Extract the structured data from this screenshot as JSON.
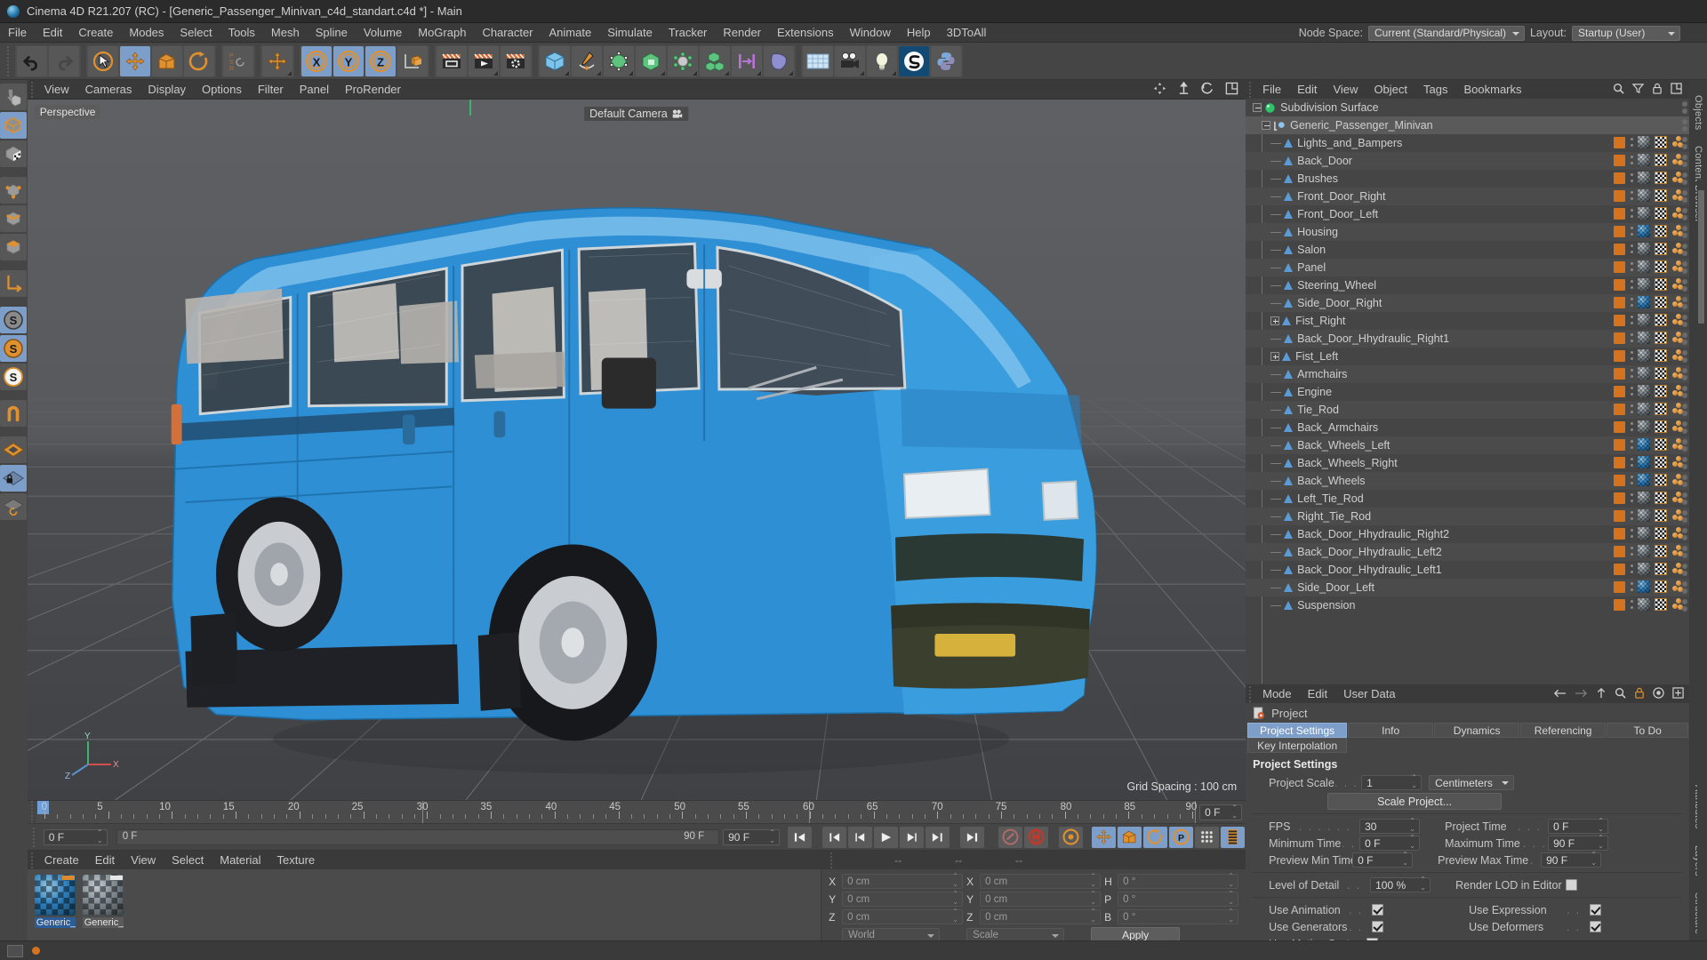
{
  "window": {
    "title": "Cinema 4D R21.207 (RC) - [Generic_Passenger_Minivan_c4d_standart.c4d *] - Main",
    "logo_icon": "cinema4d-logo-icon"
  },
  "menubar": {
    "items": [
      "File",
      "Edit",
      "Create",
      "Modes",
      "Select",
      "Tools",
      "Mesh",
      "Spline",
      "Volume",
      "MoGraph",
      "Character",
      "Animate",
      "Simulate",
      "Tracker",
      "Render",
      "Extensions",
      "Window",
      "Help",
      "3DToAll"
    ]
  },
  "topright": {
    "node_space_label": "Node Space:",
    "node_space_value": "Current (Standard/Physical)",
    "layout_label": "Layout:",
    "layout_value": "Startup (User)"
  },
  "toolbar": {
    "groups": [
      {
        "name": "history",
        "buttons": [
          {
            "icon": "undo-icon",
            "label": "Undo",
            "active": false
          },
          {
            "icon": "redo-icon",
            "label": "Redo",
            "active": false,
            "disabled": true
          }
        ]
      },
      {
        "name": "transform",
        "buttons": [
          {
            "icon": "select-cursor-icon",
            "label": "Live Selection",
            "active": false
          },
          {
            "icon": "move-icon",
            "label": "Move",
            "active": true
          },
          {
            "icon": "scale-icon",
            "label": "Scale",
            "active": false
          },
          {
            "icon": "rotate-icon",
            "label": "Rotate",
            "active": false
          }
        ]
      },
      {
        "name": "psr",
        "buttons": [
          {
            "icon": "psr-lock-icon",
            "label": "PSR Lock",
            "active": false
          }
        ]
      },
      {
        "name": "world",
        "buttons": [
          {
            "icon": "world-object-axis-icon",
            "label": "World/Object Axis",
            "active": false
          }
        ]
      },
      {
        "name": "axes",
        "buttons": [
          {
            "icon": "x-axis-icon",
            "label": "X Axis",
            "active": true
          },
          {
            "icon": "y-axis-icon",
            "label": "Y Axis",
            "active": true
          },
          {
            "icon": "z-axis-icon",
            "label": "Z Axis",
            "active": true
          },
          {
            "icon": "axis-object-icon",
            "label": "Object Axis",
            "active": false
          }
        ]
      },
      {
        "name": "render",
        "buttons": [
          {
            "icon": "render-view-icon",
            "label": "Render View",
            "active": false
          },
          {
            "icon": "render-region-icon",
            "label": "Render to Picture Viewer",
            "active": false
          },
          {
            "icon": "render-settings-icon",
            "label": "Render Settings",
            "active": false
          }
        ]
      },
      {
        "name": "primitives",
        "buttons": [
          {
            "icon": "cube-icon",
            "label": "Cube",
            "active": false
          },
          {
            "icon": "pen-spline-icon",
            "label": "Pen",
            "active": false
          },
          {
            "icon": "subdivision-surface-icon",
            "label": "Subdivision Surface",
            "active": false
          },
          {
            "icon": "array-icon",
            "label": "Array",
            "active": false
          },
          {
            "icon": "deformer-icon",
            "label": "Bend Deformer",
            "active": false
          },
          {
            "icon": "mograph-cloner-icon",
            "label": "MoGraph Cloner",
            "active": false
          },
          {
            "icon": "field-icon",
            "label": "Field",
            "active": false
          },
          {
            "icon": "cloth-icon",
            "label": "Simulation",
            "active": false
          }
        ]
      },
      {
        "name": "scene",
        "buttons": [
          {
            "icon": "floor-icon",
            "label": "Floor",
            "active": false
          },
          {
            "icon": "camera-icon",
            "label": "Camera",
            "active": false
          },
          {
            "icon": "light-icon",
            "label": "Light",
            "active": false
          },
          {
            "icon": "cineversity-icon",
            "label": "Cineversity",
            "active": false
          },
          {
            "icon": "python-icon",
            "label": "Python",
            "active": false
          }
        ]
      }
    ]
  },
  "lefttools": {
    "buttons": [
      {
        "icon": "make-editable-icon",
        "active": false
      },
      {
        "icon": "model-mode-icon",
        "active": true
      },
      {
        "icon": "texture-mode-icon",
        "active": false
      },
      {
        "icon": "points-mode-icon",
        "active": false
      },
      {
        "icon": "edges-mode-icon",
        "active": false
      },
      {
        "icon": "polygons-mode-icon",
        "active": false
      },
      {
        "icon": "axis-modify-icon",
        "active": false
      },
      {
        "icon": "enable-axis-icon",
        "active": true
      },
      {
        "icon": "viewport-solo-single-icon",
        "active": true
      },
      {
        "icon": "viewport-solo-hierarchy-icon",
        "active": false
      },
      {
        "icon": "snap-icon",
        "active": false
      },
      {
        "icon": "workplane-icon",
        "active": false
      },
      {
        "icon": "lock-workplane-icon",
        "active": true
      },
      {
        "icon": "planar-workplane-icon",
        "active": false
      }
    ]
  },
  "viewport": {
    "menu": [
      "View",
      "Cameras",
      "Display",
      "Options",
      "Filter",
      "Panel",
      "ProRender"
    ],
    "perspective_label": "Perspective",
    "camera_label": "Default Camera",
    "grid_spacing": "Grid Spacing : 100 cm",
    "corner_icons": [
      "pan-view-icon",
      "zoom-view-icon",
      "rotate-view-icon",
      "maximize-view-icon"
    ],
    "axis_gizmo": {
      "x": "X",
      "y": "Y",
      "z": "Z"
    }
  },
  "timeline": {
    "ticks": [
      0,
      5,
      10,
      15,
      20,
      25,
      30,
      35,
      40,
      45,
      50,
      55,
      60,
      65,
      70,
      75,
      80,
      85,
      90
    ],
    "current_frame": "0 F",
    "start_field": "0 F",
    "start_marker": "0 F",
    "end_marker": "90 F",
    "end_field": "90 F",
    "right_field": "0 F",
    "transport": [
      {
        "icon": "go-to-start-icon"
      },
      {
        "icon": "previous-key-icon"
      },
      {
        "icon": "previous-frame-icon"
      },
      {
        "icon": "play-icon"
      },
      {
        "icon": "next-frame-icon"
      },
      {
        "icon": "next-key-icon"
      },
      {
        "icon": "go-to-end-icon"
      }
    ],
    "record_tools": [
      {
        "icon": "autokey-icon",
        "active": false
      },
      {
        "icon": "record-active-objects-icon",
        "active": false
      },
      {
        "icon": "keyframe-selection-icon",
        "active": false
      },
      {
        "icon": "record-position-icon",
        "active": true
      },
      {
        "icon": "record-scale-icon",
        "active": true
      },
      {
        "icon": "record-rotation-icon",
        "active": true
      },
      {
        "icon": "record-parameter-icon",
        "active": true
      },
      {
        "icon": "point-level-animation-icon",
        "active": false
      },
      {
        "icon": "timeline-toggle-icon",
        "active": true
      }
    ]
  },
  "material_manager": {
    "menu": [
      "Create",
      "Edit",
      "View",
      "Select",
      "Material",
      "Texture"
    ],
    "materials": [
      {
        "name": "Generic_",
        "selected": true,
        "swatch": "blue"
      },
      {
        "name": "Generic_",
        "selected": false,
        "swatch": "white"
      }
    ]
  },
  "coordinates": {
    "headers": [
      "--",
      "--",
      "--"
    ],
    "position": {
      "label_x": "X",
      "label_y": "Y",
      "label_z": "Z",
      "x": "0 cm",
      "y": "0 cm",
      "z": "0 cm"
    },
    "size": {
      "label_x": "X",
      "label_y": "Y",
      "label_z": "Z",
      "x": "0 cm",
      "y": "0 cm",
      "z": "0 cm"
    },
    "rotation": {
      "label_h": "H",
      "label_p": "P",
      "label_b": "B",
      "h": "0 °",
      "p": "0 °",
      "b": "0 °"
    },
    "coord_system": "World",
    "transform_mode": "Scale",
    "apply_label": "Apply"
  },
  "object_manager": {
    "menu": [
      "File",
      "Edit",
      "View",
      "Object",
      "Tags",
      "Bookmarks"
    ],
    "icons": [
      "search-icon",
      "filter-icon",
      "lock-icon",
      "expand-icon"
    ],
    "items": [
      {
        "label": "Subdivision Surface",
        "depth": 0,
        "icon": "subdivision-surface-icon",
        "expander": "minus",
        "tags": [],
        "selected": false
      },
      {
        "label": "Generic_Passenger_Minivan",
        "depth": 1,
        "icon": "null-object-icon",
        "expander": "minus",
        "tags": [],
        "selected": true
      },
      {
        "label": "Lights_and_Bampers",
        "depth": 2,
        "icon": "polygon-object-icon",
        "tags": [
          "display",
          "material-grey",
          "checker",
          "beads"
        ],
        "selected": false
      },
      {
        "label": "Back_Door",
        "depth": 2,
        "icon": "polygon-object-icon",
        "tags": [
          "display",
          "material-grey",
          "checker",
          "beads"
        ],
        "selected": false
      },
      {
        "label": "Brushes",
        "depth": 2,
        "icon": "polygon-object-icon",
        "tags": [
          "display",
          "material-grey",
          "checker",
          "beads"
        ],
        "selected": false
      },
      {
        "label": "Front_Door_Right",
        "depth": 2,
        "icon": "polygon-object-icon",
        "tags": [
          "display",
          "material-grey",
          "checker",
          "beads"
        ],
        "selected": false
      },
      {
        "label": "Front_Door_Left",
        "depth": 2,
        "icon": "polygon-object-icon",
        "tags": [
          "display",
          "material-grey",
          "checker",
          "beads"
        ],
        "selected": false
      },
      {
        "label": "Housing",
        "depth": 2,
        "icon": "polygon-object-icon",
        "tags": [
          "display",
          "material-blue",
          "checker",
          "beads"
        ],
        "selected": false
      },
      {
        "label": "Salon",
        "depth": 2,
        "icon": "polygon-object-icon",
        "tags": [
          "display",
          "material-grey",
          "checker",
          "beads"
        ],
        "selected": false
      },
      {
        "label": "Panel",
        "depth": 2,
        "icon": "polygon-object-icon",
        "tags": [
          "display",
          "material-grey",
          "checker",
          "beads"
        ],
        "selected": false
      },
      {
        "label": "Steering_Wheel",
        "depth": 2,
        "icon": "polygon-object-icon",
        "tags": [
          "display",
          "material-grey",
          "checker",
          "beads"
        ],
        "selected": false
      },
      {
        "label": "Side_Door_Right",
        "depth": 2,
        "icon": "polygon-object-icon",
        "tags": [
          "display",
          "material-blue",
          "checker",
          "beads"
        ],
        "selected": false
      },
      {
        "label": "Fist_Right",
        "depth": 2,
        "icon": "polygon-object-icon",
        "expander": "plus",
        "tags": [
          "display",
          "material-grey",
          "checker",
          "beads"
        ],
        "selected": false
      },
      {
        "label": "Back_Door_Hhydraulic_Right1",
        "depth": 2,
        "icon": "polygon-object-icon",
        "tags": [
          "display",
          "material-grey",
          "checker",
          "beads"
        ],
        "selected": false
      },
      {
        "label": "Fist_Left",
        "depth": 2,
        "icon": "polygon-object-icon",
        "expander": "plus",
        "tags": [
          "display",
          "material-grey",
          "checker",
          "beads"
        ],
        "selected": false
      },
      {
        "label": "Armchairs",
        "depth": 2,
        "icon": "polygon-object-icon",
        "tags": [
          "display",
          "material-grey",
          "checker",
          "beads"
        ],
        "selected": false
      },
      {
        "label": "Engine",
        "depth": 2,
        "icon": "polygon-object-icon",
        "tags": [
          "display",
          "material-grey",
          "checker",
          "beads"
        ],
        "selected": false
      },
      {
        "label": "Tie_Rod",
        "depth": 2,
        "icon": "polygon-object-icon",
        "tags": [
          "display",
          "material-grey",
          "checker",
          "beads"
        ],
        "selected": false
      },
      {
        "label": "Back_Armchairs",
        "depth": 2,
        "icon": "polygon-object-icon",
        "tags": [
          "display",
          "material-grey",
          "checker",
          "beads"
        ],
        "selected": false
      },
      {
        "label": "Back_Wheels_Left",
        "depth": 2,
        "icon": "polygon-object-icon",
        "tags": [
          "display",
          "material-blue",
          "checker",
          "beads"
        ],
        "selected": false
      },
      {
        "label": "Back_Wheels_Right",
        "depth": 2,
        "icon": "polygon-object-icon",
        "tags": [
          "display",
          "material-blue",
          "checker",
          "beads"
        ],
        "selected": false
      },
      {
        "label": "Back_Wheels",
        "depth": 2,
        "icon": "polygon-object-icon",
        "tags": [
          "display",
          "material-blue",
          "checker",
          "beads"
        ],
        "selected": false
      },
      {
        "label": "Left_Tie_Rod",
        "depth": 2,
        "icon": "polygon-object-icon",
        "tags": [
          "display",
          "material-grey",
          "checker",
          "beads"
        ],
        "selected": false
      },
      {
        "label": "Right_Tie_Rod",
        "depth": 2,
        "icon": "polygon-object-icon",
        "tags": [
          "display",
          "material-grey",
          "checker",
          "beads"
        ],
        "selected": false
      },
      {
        "label": "Back_Door_Hhydraulic_Right2",
        "depth": 2,
        "icon": "polygon-object-icon",
        "tags": [
          "display",
          "material-grey",
          "checker",
          "beads"
        ],
        "selected": false
      },
      {
        "label": "Back_Door_Hhydraulic_Left2",
        "depth": 2,
        "icon": "polygon-object-icon",
        "tags": [
          "display",
          "material-grey",
          "checker",
          "beads"
        ],
        "selected": false
      },
      {
        "label": "Back_Door_Hhydraulic_Left1",
        "depth": 2,
        "icon": "polygon-object-icon",
        "tags": [
          "display",
          "material-grey",
          "checker",
          "beads"
        ],
        "selected": false
      },
      {
        "label": "Side_Door_Left",
        "depth": 2,
        "icon": "polygon-object-icon",
        "tags": [
          "display",
          "material-blue",
          "checker",
          "beads"
        ],
        "selected": false
      },
      {
        "label": "Suspension",
        "depth": 2,
        "icon": "polygon-object-icon",
        "tags": [
          "display",
          "material-grey",
          "checker",
          "beads"
        ],
        "selected": false
      }
    ]
  },
  "attributes": {
    "menu": [
      "Mode",
      "Edit",
      "User Data"
    ],
    "icons": [
      "back-arrow-icon",
      "forward-arrow-icon",
      "up-arrow-icon",
      "search-icon",
      "lock-icon",
      "record-icon",
      "add-icon"
    ],
    "object_label": "Project",
    "object_icon": "project-settings-icon",
    "tabs": [
      {
        "label": "Project Settings",
        "selected": true
      },
      {
        "label": "Info",
        "selected": false
      },
      {
        "label": "Dynamics",
        "selected": false
      },
      {
        "label": "Referencing",
        "selected": false
      },
      {
        "label": "To Do",
        "selected": false
      }
    ],
    "tabs_row2": [
      {
        "label": "Key Interpolation",
        "selected": false
      }
    ],
    "section_title": "Project Settings",
    "fields": {
      "project_scale_label": "Project Scale",
      "project_scale_value": "1",
      "project_scale_unit": "Centimeters",
      "scale_project_button": "Scale Project...",
      "fps_label": "FPS",
      "fps_value": "30",
      "project_time_label": "Project Time",
      "project_time_value": "0 F",
      "minimum_time_label": "Minimum Time",
      "minimum_time_value": "0 F",
      "maximum_time_label": "Maximum Time",
      "maximum_time_value": "90 F",
      "preview_min_label": "Preview Min Time",
      "preview_min_value": "0 F",
      "preview_max_label": "Preview Max Time",
      "preview_max_value": "90 F",
      "lod_label": "Level of Detail",
      "lod_value": "100 %",
      "render_lod_label": "Render LOD in Editor",
      "render_lod_checked": false,
      "use_animation_label": "Use Animation",
      "use_animation_checked": true,
      "use_expression_label": "Use Expression",
      "use_expression_checked": true,
      "use_generators_label": "Use Generators",
      "use_generators_checked": true,
      "use_deformers_label": "Use Deformers",
      "use_deformers_checked": true,
      "use_motion_label": "Use Motion System",
      "use_motion_checked": true
    }
  },
  "right_tabs": [
    "Objects",
    "Content Browser",
    "Attributes",
    "Layers",
    "Structure"
  ],
  "statusbar": {
    "message": ""
  }
}
